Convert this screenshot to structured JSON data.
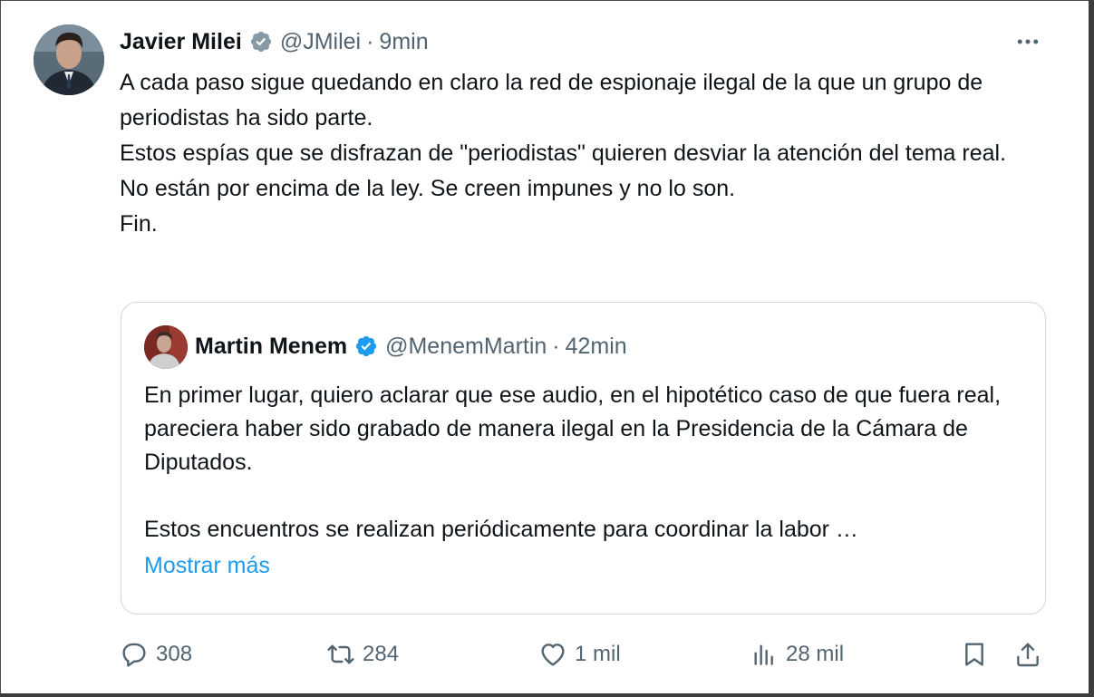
{
  "tweet": {
    "author_name": "Javier Milei",
    "handle": "@JMilei",
    "separator": "·",
    "time": "9min",
    "text": "A cada paso sigue quedando en claro la red de espionaje ilegal de la que un grupo de periodistas ha sido parte.\nEstos espías que se disfrazan de \"periodistas\" quieren desviar la atención del tema real.\nNo están por encima de la ley. Se creen impunes y no lo son.\nFin.",
    "more_icon": "more-horizontal-icon"
  },
  "quoted": {
    "author_name": "Martin Menem",
    "handle": "@MenemMartin",
    "separator": "·",
    "time": "42min",
    "text": "En primer lugar, quiero aclarar que ese audio, en el hipotético caso de que fuera real, pareciera haber sido grabado de manera ilegal en la Presidencia de la Cámara de Diputados.\n\nEstos encuentros se realizan periódicamente para coordinar la labor …",
    "show_more": "Mostrar más"
  },
  "actions": {
    "replies": "308",
    "reposts": "284",
    "likes": "1 mil",
    "views": "28 mil"
  },
  "colors": {
    "text": "#0f1419",
    "secondary": "#536471",
    "accent": "#1d9bf0",
    "border": "#cfd9de"
  }
}
